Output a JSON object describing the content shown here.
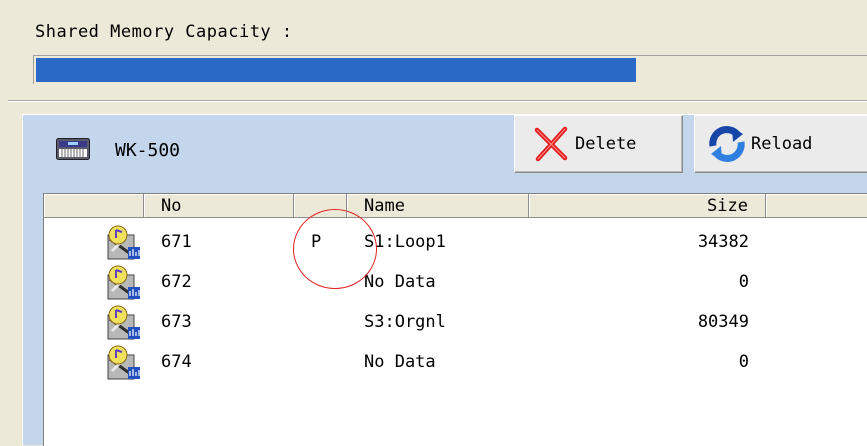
{
  "memory": {
    "label": "Shared Memory Capacity :",
    "used_fraction": 0.72
  },
  "device": {
    "name": "WK-500",
    "icon": "keyboard-icon"
  },
  "toolbar": {
    "delete_label": "Delete",
    "delete_icon": "red-x-icon",
    "reload_label": "Reload",
    "reload_icon": "refresh-arrows-icon"
  },
  "table": {
    "columns": [
      "",
      "No",
      "",
      "Name",
      "Size",
      ""
    ],
    "rows": [
      {
        "no": "671",
        "p": "P",
        "name": "S1:Loop1",
        "size": "34382"
      },
      {
        "no": "672",
        "p": "",
        "name": "No Data",
        "size": "0"
      },
      {
        "no": "673",
        "p": "",
        "name": "S3:Orgnl",
        "size": "80349"
      },
      {
        "no": "674",
        "p": "",
        "name": "No Data",
        "size": "0"
      }
    ]
  },
  "colors": {
    "progress": "#2a69c5",
    "panel": "#c3d6ec",
    "highlight_circle": "#e02020"
  }
}
